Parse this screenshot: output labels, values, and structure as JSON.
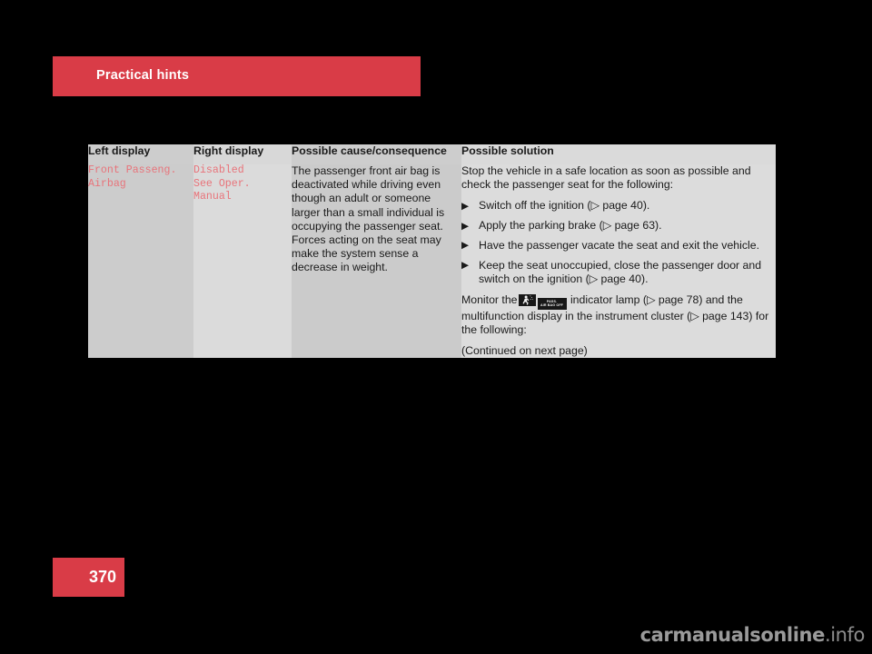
{
  "section": {
    "title": "Practical hints",
    "banner_color": "#d93c47"
  },
  "table": {
    "headers": {
      "left_display": "Left display",
      "right_display": "Right display",
      "cause": "Possible cause/consequence",
      "solution": "Possible solution"
    },
    "row": {
      "left_display": "Front Passeng.\nAirbag",
      "right_display": "Disabled\nSee Oper. Manual",
      "cause": "The passenger front air bag is deactivated while driving even though an adult or someone larger than a small individual is occupying the passenger seat. Forces acting on the seat may make the system sense a decrease in weight.",
      "solution": {
        "intro": "Stop the vehicle in a safe location as soon as possible and check the passenger seat for the following:",
        "bullets": [
          "Switch off the ignition (▷ page 40).",
          "Apply the parking brake (▷ page 63).",
          "Have the passenger vacate the seat and exit the vehicle.",
          "Keep the seat unoccupied, close the passenger door and switch on the ignition (▷ page 40)."
        ],
        "monitor_prefix": "Monitor the",
        "lamp_icon_1": "passenger-airbag-figure-icon",
        "lamp_icon_2_line1": "PASS.",
        "lamp_icon_2_line2": "AIR BAG  OFF",
        "monitor_suffix": "indicator lamp (▷ page 78) and the multifunction display in the instrument cluster (▷ page 143) for the following:",
        "continued": "(Continued on next page)"
      }
    }
  },
  "footer": {
    "page_number": "370",
    "watermark_main": "carmanualsonline",
    "watermark_suffix": ".info"
  },
  "colors": {
    "accent_red": "#d93c47",
    "display_text_red": "#e8737a",
    "col_dark": "#cccccc",
    "col_light": "#dcdcdc"
  }
}
